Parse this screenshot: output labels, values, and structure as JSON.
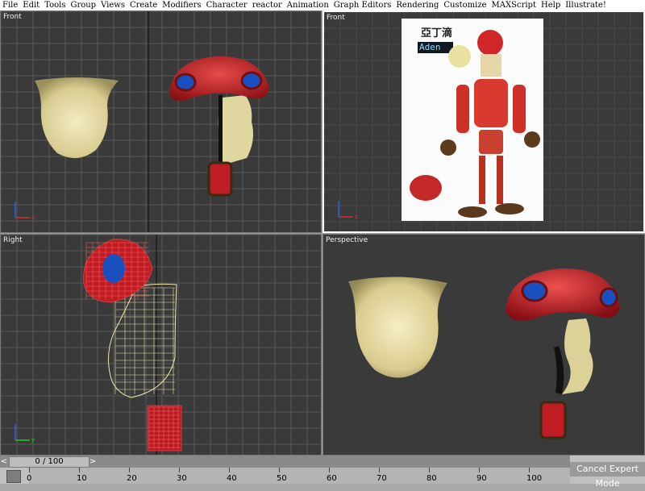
{
  "menu": [
    "File",
    "Edit",
    "Tools",
    "Group",
    "Views",
    "Create",
    "Modifiers",
    "Character",
    "reactor",
    "Animation",
    "Graph Editors",
    "Rendering",
    "Customize",
    "MAXScript",
    "Help",
    "Illustrate!"
  ],
  "viewports": {
    "top_left": "Front",
    "top_right": "Front",
    "bottom_left": "Right",
    "bottom_right": "Perspective"
  },
  "reference": {
    "title": "亞丁滴",
    "name": "Aden"
  },
  "axis": {
    "x": "x",
    "y": "y",
    "z": "z"
  },
  "timeline": {
    "frame_display": "0 / 100",
    "prev_arrow": "<",
    "next_arrow": ">",
    "ticks": [
      "0",
      "10",
      "20",
      "30",
      "40",
      "50",
      "60",
      "70",
      "80",
      "90",
      "100"
    ]
  },
  "status": {
    "cancel_expert": "Cancel Expert Mode"
  },
  "colors": {
    "viewport_bg": "#3a3a3a",
    "helmet": "#c8222a",
    "face": "#e6dca8",
    "eye": "#1a4fc0"
  }
}
